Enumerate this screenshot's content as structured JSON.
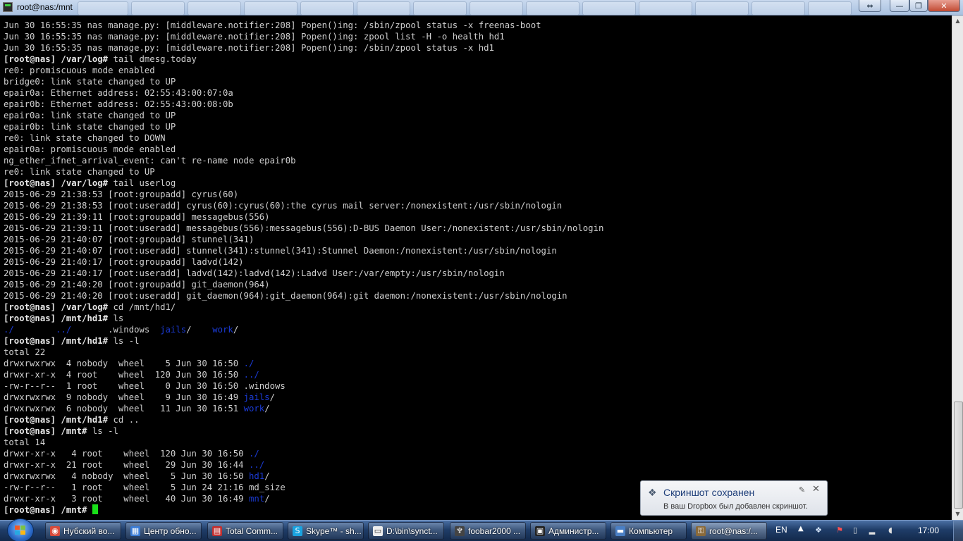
{
  "window": {
    "title": "root@nas:/mnt",
    "controls": {
      "restore_wide": "⇔",
      "minimize": "—",
      "maximize": "❐",
      "close": "✕"
    }
  },
  "terminal": {
    "lines": [
      [
        {
          "t": "Jun 30 16:55:35 nas manage.py: [middleware.notifier:208] Popen()ing: /sbin/zpool status -x freenas-boot"
        }
      ],
      [
        {
          "t": "Jun 30 16:55:35 nas manage.py: [middleware.notifier:208] Popen()ing: zpool list -H -o health hd1"
        }
      ],
      [
        {
          "t": "Jun 30 16:55:35 nas manage.py: [middleware.notifier:208] Popen()ing: /sbin/zpool status -x hd1"
        }
      ],
      [
        {
          "t": "[root@nas] /var/log#",
          "k": "prompt"
        },
        {
          "t": " tail dmesg.today"
        }
      ],
      [
        {
          "t": "re0: promiscuous mode enabled"
        }
      ],
      [
        {
          "t": "bridge0: link state changed to UP"
        }
      ],
      [
        {
          "t": "epair0a: Ethernet address: 02:55:43:00:07:0a"
        }
      ],
      [
        {
          "t": "epair0b: Ethernet address: 02:55:43:00:08:0b"
        }
      ],
      [
        {
          "t": "epair0a: link state changed to UP"
        }
      ],
      [
        {
          "t": "epair0b: link state changed to UP"
        }
      ],
      [
        {
          "t": "re0: link state changed to DOWN"
        }
      ],
      [
        {
          "t": "epair0a: promiscuous mode enabled"
        }
      ],
      [
        {
          "t": "ng_ether_ifnet_arrival_event: can't re-name node epair0b"
        }
      ],
      [
        {
          "t": "re0: link state changed to UP"
        }
      ],
      [
        {
          "t": "[root@nas] /var/log#",
          "k": "prompt"
        },
        {
          "t": " tail userlog"
        }
      ],
      [
        {
          "t": "2015-06-29 21:38:53 [root:groupadd] cyrus(60)"
        }
      ],
      [
        {
          "t": "2015-06-29 21:38:53 [root:useradd] cyrus(60):cyrus(60):the cyrus mail server:/nonexistent:/usr/sbin/nologin"
        }
      ],
      [
        {
          "t": "2015-06-29 21:39:11 [root:groupadd] messagebus(556)"
        }
      ],
      [
        {
          "t": "2015-06-29 21:39:11 [root:useradd] messagebus(556):messagebus(556):D-BUS Daemon User:/nonexistent:/usr/sbin/nologin"
        }
      ],
      [
        {
          "t": "2015-06-29 21:40:07 [root:groupadd] stunnel(341)"
        }
      ],
      [
        {
          "t": "2015-06-29 21:40:07 [root:useradd] stunnel(341):stunnel(341):Stunnel Daemon:/nonexistent:/usr/sbin/nologin"
        }
      ],
      [
        {
          "t": "2015-06-29 21:40:17 [root:groupadd] ladvd(142)"
        }
      ],
      [
        {
          "t": "2015-06-29 21:40:17 [root:useradd] ladvd(142):ladvd(142):Ladvd User:/var/empty:/usr/sbin/nologin"
        }
      ],
      [
        {
          "t": "2015-06-29 21:40:20 [root:groupadd] git_daemon(964)"
        }
      ],
      [
        {
          "t": "2015-06-29 21:40:20 [root:useradd] git_daemon(964):git_daemon(964):git daemon:/nonexistent:/usr/sbin/nologin"
        }
      ],
      [
        {
          "t": "[root@nas] /var/log#",
          "k": "prompt"
        },
        {
          "t": " cd /mnt/hd1/"
        }
      ],
      [
        {
          "t": "[root@nas] /mnt/hd1#",
          "k": "prompt"
        },
        {
          "t": " ls"
        }
      ],
      [
        {
          "t": "./",
          "k": "dir"
        },
        {
          "t": "        "
        },
        {
          "t": "../",
          "k": "dir"
        },
        {
          "t": "       .windows  "
        },
        {
          "t": "jails",
          "k": "dir"
        },
        {
          "t": "/    "
        },
        {
          "t": "work",
          "k": "dir"
        },
        {
          "t": "/"
        }
      ],
      [
        {
          "t": "[root@nas] /mnt/hd1#",
          "k": "prompt"
        },
        {
          "t": " ls -l"
        }
      ],
      [
        {
          "t": "total 22"
        }
      ],
      [
        {
          "t": "drwxrwxrwx  4 nobody  wheel    5 Jun 30 16:50 "
        },
        {
          "t": "./",
          "k": "dir"
        }
      ],
      [
        {
          "t": "drwxr-xr-x  4 root    wheel  120 Jun 30 16:50 "
        },
        {
          "t": "../",
          "k": "dir"
        }
      ],
      [
        {
          "t": "-rw-r--r--  1 root    wheel    0 Jun 30 16:50 .windows"
        }
      ],
      [
        {
          "t": "drwxrwxrwx  9 nobody  wheel    9 Jun 30 16:49 "
        },
        {
          "t": "jails",
          "k": "dir"
        },
        {
          "t": "/"
        }
      ],
      [
        {
          "t": "drwxrwxrwx  6 nobody  wheel   11 Jun 30 16:51 "
        },
        {
          "t": "work",
          "k": "dir"
        },
        {
          "t": "/"
        }
      ],
      [
        {
          "t": "[root@nas] /mnt/hd1#",
          "k": "prompt"
        },
        {
          "t": " cd .."
        }
      ],
      [
        {
          "t": "[root@nas] /mnt#",
          "k": "prompt"
        },
        {
          "t": " ls -l"
        }
      ],
      [
        {
          "t": "total 14"
        }
      ],
      [
        {
          "t": "drwxr-xr-x   4 root    wheel  120 Jun 30 16:50 "
        },
        {
          "t": "./",
          "k": "dir"
        }
      ],
      [
        {
          "t": "drwxr-xr-x  21 root    wheel   29 Jun 30 16:44 "
        },
        {
          "t": "../",
          "k": "dir"
        }
      ],
      [
        {
          "t": "drwxrwxrwx   4 nobody  wheel    5 Jun 30 16:50 "
        },
        {
          "t": "hd1",
          "k": "dir"
        },
        {
          "t": "/"
        }
      ],
      [
        {
          "t": "-rw-r--r--   1 root    wheel    5 Jun 24 21:16 md_size"
        }
      ],
      [
        {
          "t": "drwxr-xr-x   3 root    wheel   40 Jun 30 16:49 "
        },
        {
          "t": "mnt",
          "k": "dir"
        },
        {
          "t": "/"
        }
      ],
      [
        {
          "t": "[root@nas] /mnt#",
          "k": "prompt"
        },
        {
          "t": " "
        },
        {
          "k": "cursor"
        }
      ]
    ]
  },
  "notification": {
    "title": "Скриншот сохранен",
    "body": "В ваш Dropbox был добавлен скриншот.",
    "icon": "dropbox-icon",
    "pin": "pin-icon",
    "close": "✕"
  },
  "taskbar": {
    "tasks": [
      {
        "id": "chrome",
        "label": "Нубский во...",
        "icon": "chrome-icon",
        "color": "#d94a3a",
        "glyph": "◉",
        "active": false
      },
      {
        "id": "update-center",
        "label": "Центр обно...",
        "icon": "windows-update-icon",
        "color": "#3a7bd5",
        "glyph": "▦",
        "active": false
      },
      {
        "id": "total-commander",
        "label": "Total Comm...",
        "icon": "floppy-icon",
        "color": "#c23030",
        "glyph": "▤",
        "active": false
      },
      {
        "id": "skype",
        "label": "Skype™ - sh...",
        "icon": "skype-icon",
        "color": "#1aa3e0",
        "glyph": "S",
        "active": false
      },
      {
        "id": "synct",
        "label": "D:\\bin\\synct...",
        "icon": "console-window-icon",
        "color": "#eeeeee",
        "glyph": "▭",
        "active": false
      },
      {
        "id": "foobar",
        "label": "foobar2000 ...",
        "icon": "foobar-icon",
        "color": "#444444",
        "glyph": "♆",
        "active": false
      },
      {
        "id": "admin",
        "label": "Администр...",
        "icon": "cmd-icon",
        "color": "#222222",
        "glyph": "▣",
        "active": false
      },
      {
        "id": "computer",
        "label": "Компьютер",
        "icon": "computer-icon",
        "color": "#4a7fc4",
        "glyph": "▬",
        "active": false
      },
      {
        "id": "putty",
        "label": "root@nas:/...",
        "icon": "putty-icon",
        "color": "#8a6a3a",
        "glyph": "⚿",
        "active": true
      }
    ],
    "language": "EN",
    "tray_arrow": "▲",
    "tray_icons": [
      {
        "name": "dropbox-tray-icon",
        "glyph": "❖",
        "color": "#d8e8ff"
      },
      {
        "name": "flag-alert-icon",
        "glyph": "⚑",
        "color": "#ff5050"
      },
      {
        "name": "safely-remove-icon",
        "glyph": "▯",
        "color": "#e0e0e0"
      },
      {
        "name": "network-signal-icon",
        "glyph": "▂",
        "color": "#e0e0e0"
      },
      {
        "name": "volume-icon",
        "glyph": "◖",
        "color": "#e0e0e0"
      }
    ],
    "clock": "17:00"
  },
  "colors": {
    "prompt": "#e6e6e6",
    "directory": "#1b3bd6",
    "cursor": "#19e019",
    "text": "#cfcfcf"
  }
}
